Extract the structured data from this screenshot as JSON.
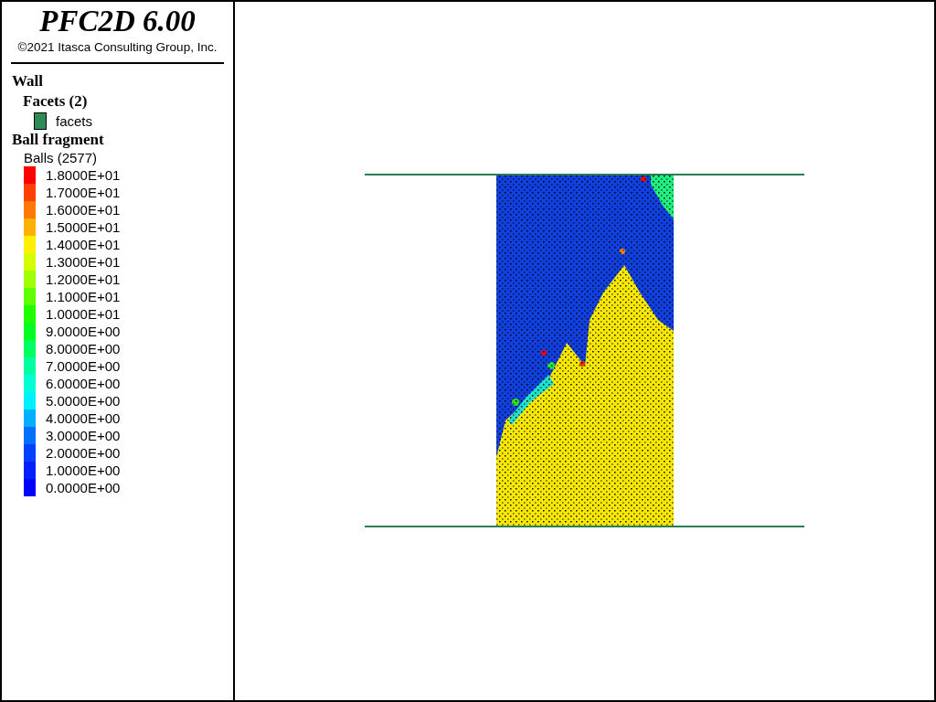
{
  "title": "PFC2D 6.00",
  "copyright": "©2021 Itasca Consulting Group, Inc.",
  "legend": {
    "wall": {
      "heading": "Wall",
      "facets_heading": "Facets (2)",
      "facets": [
        {
          "label": "facets",
          "color": "#2e8b57"
        }
      ]
    },
    "ball": {
      "heading": "Ball fragment",
      "count_label": "Balls (2577)",
      "scale": [
        {
          "label": "1.8000E+01",
          "color": "#ff0000"
        },
        {
          "label": "1.7000E+01",
          "color": "#ff4000"
        },
        {
          "label": "1.6000E+01",
          "color": "#ff7800"
        },
        {
          "label": "1.5000E+01",
          "color": "#ffb000"
        },
        {
          "label": "1.4000E+01",
          "color": "#fff000"
        },
        {
          "label": "1.3000E+01",
          "color": "#d4ff00"
        },
        {
          "label": "1.2000E+01",
          "color": "#a0ff00"
        },
        {
          "label": "1.1000E+01",
          "color": "#60ff00"
        },
        {
          "label": "1.0000E+01",
          "color": "#20ff00"
        },
        {
          "label": "9.0000E+00",
          "color": "#00ff20"
        },
        {
          "label": "8.0000E+00",
          "color": "#00ff60"
        },
        {
          "label": "7.0000E+00",
          "color": "#00ffa0"
        },
        {
          "label": "6.0000E+00",
          "color": "#00ffd4"
        },
        {
          "label": "5.0000E+00",
          "color": "#00f0ff"
        },
        {
          "label": "4.0000E+00",
          "color": "#00b0ff"
        },
        {
          "label": "3.0000E+00",
          "color": "#0070ff"
        },
        {
          "label": "2.0000E+00",
          "color": "#0040ff"
        },
        {
          "label": "1.0000E+00",
          "color": "#0020ff"
        },
        {
          "label": "0.0000E+00",
          "color": "#0000ff"
        }
      ]
    }
  }
}
